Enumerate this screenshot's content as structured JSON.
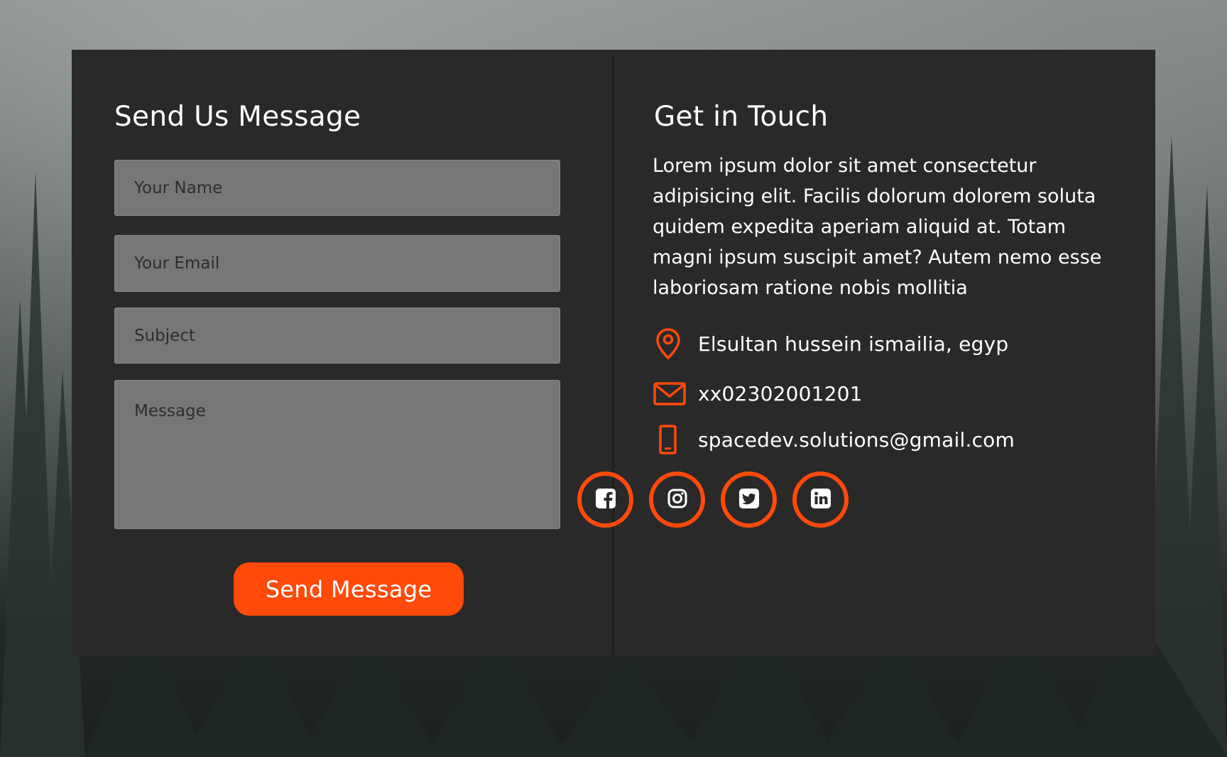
{
  "form": {
    "heading": "Send Us Message",
    "name_placeholder": "Your Name",
    "email_placeholder": "Your Email",
    "subject_placeholder": "Subject",
    "message_placeholder": "Message",
    "submit_label": "Send Message"
  },
  "contact": {
    "heading": "Get in Touch",
    "description": "Lorem ipsum dolor sit amet consectetur adipisicing elit. Facilis dolorum dolorem soluta quidem expedita aperiam aliquid at. Totam magni ipsum suscipit amet? Autem nemo esse laboriosam ratione nobis mollitia",
    "address": "Elsultan hussein ismailia, egyp",
    "phone": "xx02302001201",
    "email": "spacedev.solutions@gmail.com",
    "address_icon": "location-pin-icon",
    "phone_icon": "envelope-icon",
    "email_icon": "mobile-phone-icon"
  },
  "socials": [
    {
      "icon": "facebook-icon"
    },
    {
      "icon": "instagram-icon"
    },
    {
      "icon": "twitter-icon"
    },
    {
      "icon": "linkedin-icon"
    }
  ],
  "colors": {
    "accent": "#ff4a0a",
    "card": "#292929",
    "input": "#777777"
  }
}
